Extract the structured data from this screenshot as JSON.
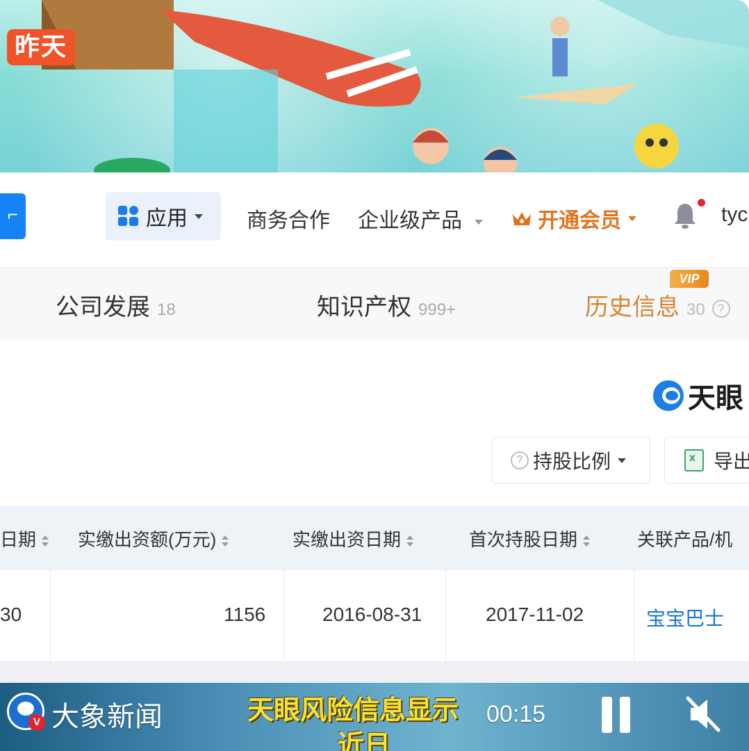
{
  "banner": {
    "badge": "昨天"
  },
  "nav": {
    "apps_label": "应用",
    "business": "商务合作",
    "enterprise": "企业级产品",
    "vip": "开通会员",
    "user_partial": "tyc"
  },
  "tabs": [
    {
      "label": "公司发展",
      "count": "18"
    },
    {
      "label": "知识产权",
      "count": "999+"
    },
    {
      "label": "历史信息",
      "count": "30",
      "tag": "VIP"
    }
  ],
  "logo": {
    "text": "天眼"
  },
  "toolbar": {
    "hold_ratio": "持股比例",
    "export_partial": "导出"
  },
  "table": {
    "headers": [
      "日期",
      "实缴出资额(万元)",
      "实缴出资日期",
      "首次持股日期",
      "关联产品/机"
    ],
    "row": [
      "30",
      "1156",
      "2016-08-31",
      "2017-11-02",
      "宝宝巴士"
    ]
  },
  "overlay": {
    "brand": "大象新闻",
    "caption_line1": "天眼风险信息显示",
    "caption_line2": "近日",
    "time": "00:15"
  },
  "colors": {
    "accent_blue": "#1583f5",
    "vip_orange": "#e0741c",
    "caption_yellow": "#f5e33a",
    "badge_red": "#f0532a"
  }
}
